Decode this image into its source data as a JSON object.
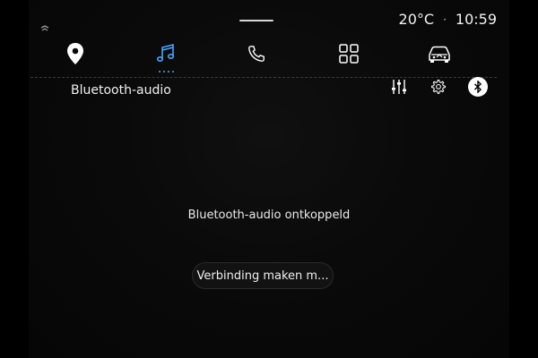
{
  "status": {
    "temperature": "20°C",
    "separator": "·",
    "time": "10:59"
  },
  "nav": {
    "items": [
      {
        "icon": "location-pin-icon",
        "active": false
      },
      {
        "icon": "music-note-icon",
        "active": true
      },
      {
        "icon": "phone-icon",
        "active": false
      },
      {
        "icon": "apps-grid-icon",
        "active": false
      },
      {
        "icon": "car-icon",
        "active": false
      }
    ]
  },
  "page": {
    "title": "Bluetooth-audio"
  },
  "tools": {
    "items": [
      {
        "icon": "equalizer-icon"
      },
      {
        "icon": "settings-gear-icon"
      },
      {
        "icon": "bluetooth-icon"
      }
    ]
  },
  "main": {
    "message": "Bluetooth-audio ontkoppeld",
    "connect_label": "Verbinding maken m..."
  },
  "colors": {
    "background": "#0a0a0a",
    "accent": "#4aa3ff",
    "text": "#ffffff"
  }
}
